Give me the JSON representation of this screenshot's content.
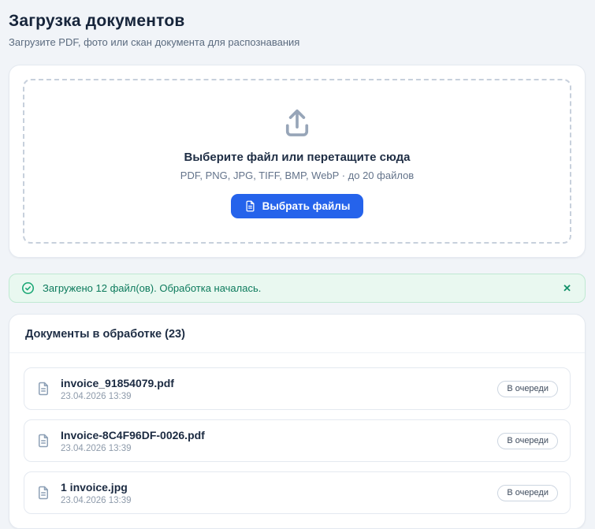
{
  "page": {
    "title": "Загрузка документов",
    "subtitle": "Загрузите PDF, фото или скан документа для распознавания"
  },
  "uploader": {
    "headline": "Выберите файл или перетащите сюда",
    "formats": "PDF, PNG, JPG, TIFF, BMP, WebP · до 20 файлов",
    "button_label": "Выбрать файлы"
  },
  "alert": {
    "message": "Загружено 12 файл(ов). Обработка началась.",
    "close_label": "✕"
  },
  "processing": {
    "heading": "Документы в обработке (23)",
    "items": [
      {
        "name": "invoice_91854079.pdf",
        "date": "23.04.2026 13:39",
        "status": "В очереди"
      },
      {
        "name": "Invoice-8C4F96DF-0026.pdf",
        "date": "23.04.2026 13:39",
        "status": "В очереди"
      },
      {
        "name": "1 invoice.jpg",
        "date": "23.04.2026 13:39",
        "status": "В очереди"
      }
    ]
  },
  "colors": {
    "accent": "#2563eb",
    "success_bg": "#e9f8f0",
    "success_border": "#bfe9d2",
    "success_text": "#0c7a5c"
  }
}
